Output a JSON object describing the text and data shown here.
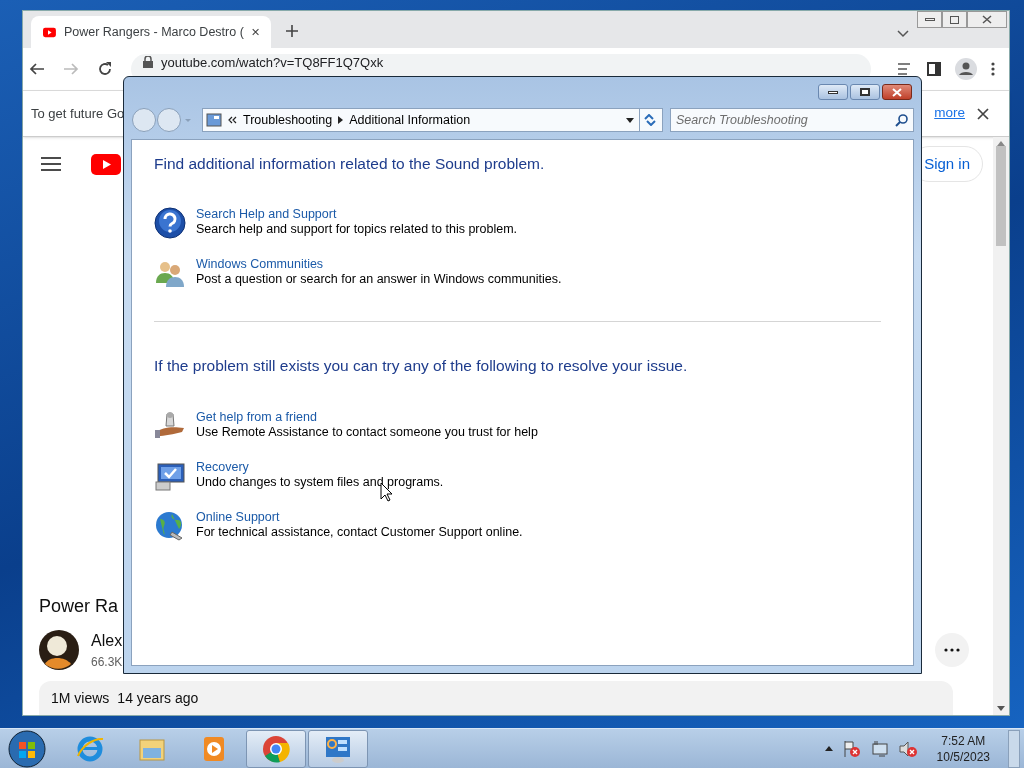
{
  "browser": {
    "tab": {
      "title": "Power Rangers - Marco Destro (",
      "selected": true
    },
    "url": "youtube.com/watch?v=TQ8FF1Q7Qxk",
    "infobar": {
      "text": "To get future Go",
      "link": "more"
    },
    "sign_in": "Sign in",
    "video_title": "Power Ra",
    "channel": {
      "name": "Alex",
      "subscribers": "66.3K"
    },
    "views": "1M views",
    "age": "14 years ago"
  },
  "dialog": {
    "breadcrumb": [
      "Troubleshooting",
      "Additional Information"
    ],
    "search_placeholder": "Search Troubleshooting",
    "sections": [
      {
        "heading": "Find additional information related to the Sound problem.",
        "items": [
          {
            "kind": "help",
            "title": "Search Help and Support",
            "description": "Search help and support for topics related to this problem."
          },
          {
            "kind": "community",
            "title": "Windows Communities",
            "description": "Post a question or search for an answer in Windows communities."
          }
        ]
      },
      {
        "heading": "If the problem still exists you can try any of the following to resolve your issue.",
        "items": [
          {
            "kind": "assist",
            "title": "Get help from a friend",
            "description": "Use Remote Assistance to contact someone you trust for help"
          },
          {
            "kind": "recovery",
            "title": "Recovery",
            "description": "Undo changes to system files and programs."
          },
          {
            "kind": "globe",
            "title": "Online Support",
            "description": "For technical assistance, contact Customer Support online."
          }
        ]
      }
    ]
  },
  "taskbar": {
    "apps": [
      {
        "kind": "ie",
        "open": false
      },
      {
        "kind": "explorer",
        "open": false
      },
      {
        "kind": "media",
        "open": false
      },
      {
        "kind": "chrome",
        "open": true
      },
      {
        "kind": "troubleshoot",
        "open": true
      }
    ],
    "time": "7:52 AM",
    "date": "10/5/2023"
  }
}
